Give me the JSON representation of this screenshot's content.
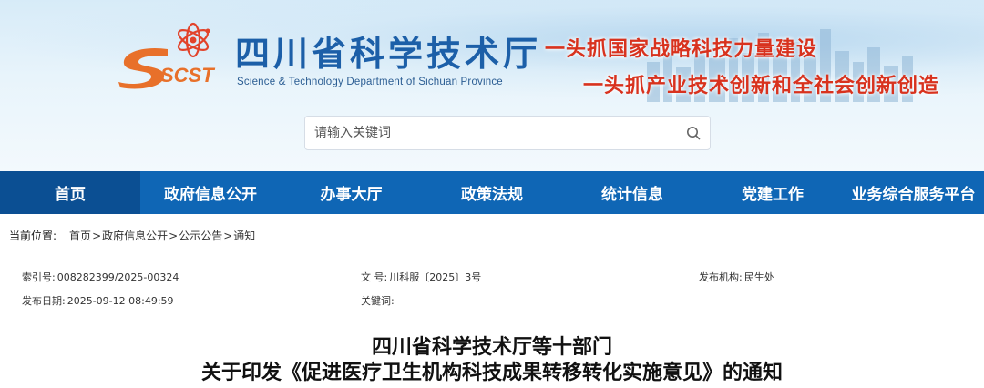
{
  "header": {
    "logo_text": "SCST",
    "title": "四川省科学技术厅",
    "subtitle": "Science & Technology Department of Sichuan Province",
    "slogans": [
      "一头抓国家战略科技力量建设",
      "一头抓产业技术创新和全社会创新创造"
    ]
  },
  "search": {
    "placeholder": "请输入关键词"
  },
  "nav": {
    "items": [
      {
        "label": "首页"
      },
      {
        "label": "政府信息公开"
      },
      {
        "label": "办事大厅"
      },
      {
        "label": "政策法规"
      },
      {
        "label": "统计信息"
      },
      {
        "label": "党建工作"
      },
      {
        "label": "业务综合服务平台"
      }
    ]
  },
  "breadcrumb": {
    "label": "当前位置:",
    "items": [
      "首页",
      "政府信息公开",
      "公示公告",
      "通知"
    ],
    "separator": ">"
  },
  "meta": {
    "index_label": "索引号:",
    "index_value": "008282399/2025-00324",
    "doc_no_label": "文 号:",
    "doc_no_value": "川科服〔2025〕3号",
    "issuer_label": "发布机构:",
    "issuer_value": "民生处",
    "date_label": "发布日期:",
    "date_value": "2025-09-12 08:49:59",
    "keywords_label": "关键词:",
    "keywords_value": ""
  },
  "article": {
    "title_line1": "四川省科学技术厅等十部门",
    "title_line2": "关于印发《促进医疗卫生机构科技成果转移转化实施意见》的通知"
  },
  "colors": {
    "nav_bg": "#0f66b5",
    "nav_active": "#0b4f93",
    "title_blue": "#1c5fa8",
    "slogan_red": "#d8321e"
  }
}
